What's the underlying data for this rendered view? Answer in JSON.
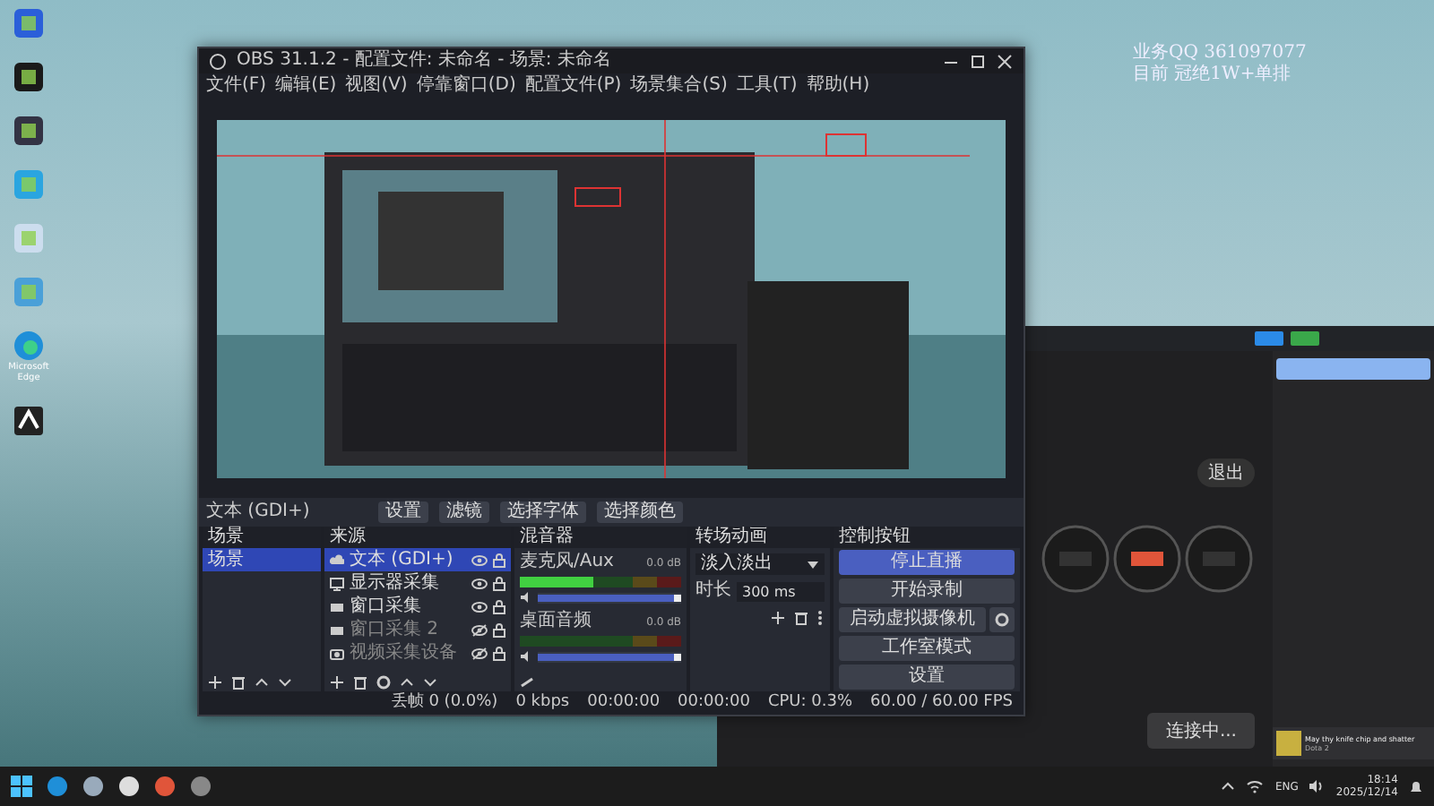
{
  "desktop": {
    "icons": [
      {
        "label": "Microsoft Edge"
      }
    ],
    "overlay_text": [
      "业务QQ 361097077",
      "目前 冠绝1W+单排"
    ]
  },
  "obs": {
    "title": "OBS 31.1.2 - 配置文件: 未命名 - 场景: 未命名",
    "menu": [
      "文件(F)",
      "编辑(E)",
      "视图(V)",
      "停靠窗口(D)",
      "配置文件(P)",
      "场景集合(S)",
      "工具(T)",
      "帮助(H)"
    ],
    "source_toolbar": {
      "source": "文本 (GDI+)",
      "buttons": [
        "设置",
        "滤镜",
        "选择字体",
        "选择颜色"
      ]
    },
    "scenes": {
      "title": "场景",
      "items": [
        {
          "label": "场景",
          "selected": true
        }
      ]
    },
    "sources": {
      "title": "来源",
      "items": [
        {
          "label": "文本 (GDI+)",
          "kind": "text",
          "visible": true,
          "selected": true
        },
        {
          "label": "显示器采集",
          "kind": "monitor",
          "visible": true,
          "selected": false
        },
        {
          "label": "窗口采集",
          "kind": "window",
          "visible": true,
          "selected": false
        },
        {
          "label": "窗口采集 2",
          "kind": "window",
          "visible": false,
          "selected": false
        },
        {
          "label": "视频采集设备",
          "kind": "camera",
          "visible": false,
          "selected": false
        }
      ]
    },
    "mixer": {
      "title": "混音器",
      "channels": [
        {
          "name": "麦克风/Aux",
          "reading": "0.0 dB",
          "meter": {
            "level": 0.45
          },
          "fader": {
            "level": 1
          }
        },
        {
          "name": "桌面音频",
          "reading": "0.0 dB",
          "meter": {
            "level": 0
          },
          "fader": {
            "level": 1
          }
        }
      ]
    },
    "transitions": {
      "title": "转场动画",
      "transition": "淡入淡出",
      "duration_label": "时长",
      "duration": "300 ms"
    },
    "controls": {
      "title": "控制按钮",
      "buttons": [
        {
          "label": "停止直播",
          "active": true
        },
        {
          "label": "开始录制",
          "active": false
        },
        {
          "label": "启动虚拟摄像机",
          "active": false
        },
        {
          "label": "工作室模式",
          "active": false
        },
        {
          "label": "设置",
          "active": false
        }
      ]
    },
    "status_bar": [
      "丢帧 0 (0.0%)",
      "0 kbps",
      "00:00:00",
      "00:00:00",
      "CPU: 0.3%",
      "60.00 / 60.00 FPS"
    ]
  },
  "live_app": {
    "exit_button": "退出",
    "connect_button": "连接中...",
    "chat_card": {
      "title": "May thy knife chip and shatter",
      "subtitle": "Dota 2"
    }
  },
  "taskbar": {
    "language": "ENG",
    "time": "18:14",
    "date": "2025/12/14"
  }
}
